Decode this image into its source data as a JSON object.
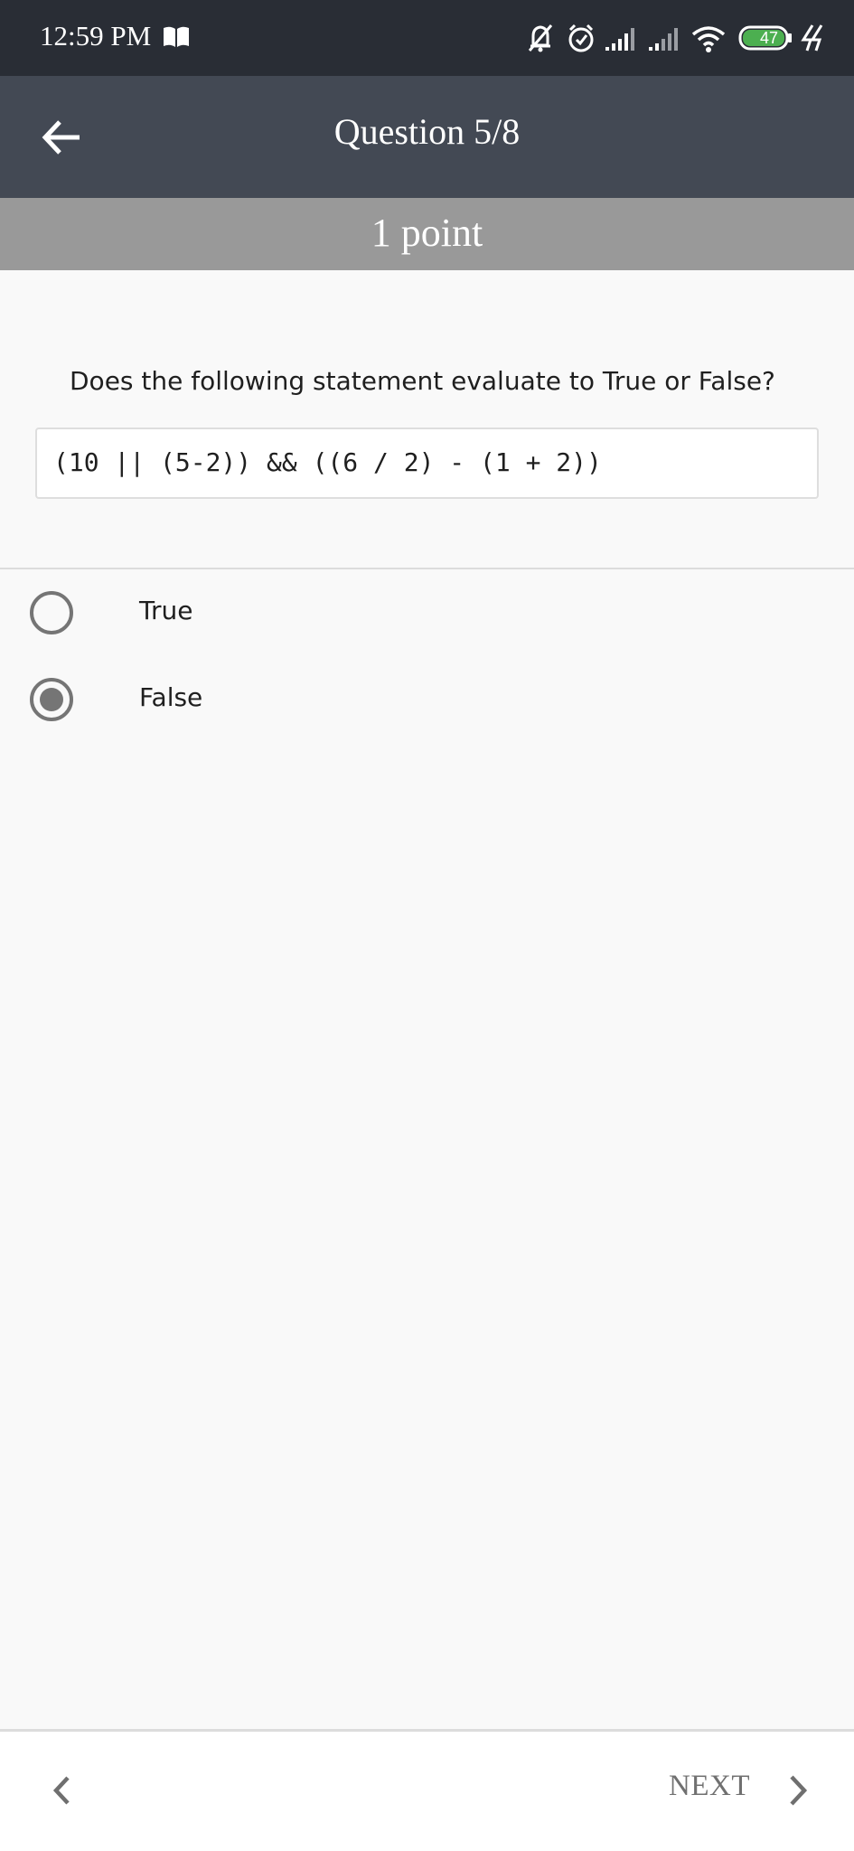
{
  "status_bar": {
    "time": "12:59 PM",
    "battery": "47",
    "icons": [
      "book-icon",
      "bell-off-icon",
      "alarm-icon",
      "signal-icon",
      "signal-weak-icon",
      "wifi-icon",
      "battery-icon",
      "charging-icon"
    ]
  },
  "app_bar": {
    "title": "Question 5/8",
    "back_icon": "arrow-left-icon"
  },
  "points": "1 point",
  "question": {
    "prompt": "Does the following statement evaluate to True or False?",
    "code": "(10 || (5-2)) && ((6 / 2) - (1 + 2))"
  },
  "options": [
    {
      "label": "True",
      "selected": false
    },
    {
      "label": "False",
      "selected": true
    }
  ],
  "bottom_nav": {
    "prev_icon": "chevron-left-icon",
    "next_label": "NEXT",
    "next_icon": "chevron-right-icon"
  },
  "colors": {
    "status_bar": "#292d35",
    "app_bar": "#434954",
    "points_band": "#999999",
    "radio": "#757575",
    "battery_fill": "#4caf50"
  }
}
